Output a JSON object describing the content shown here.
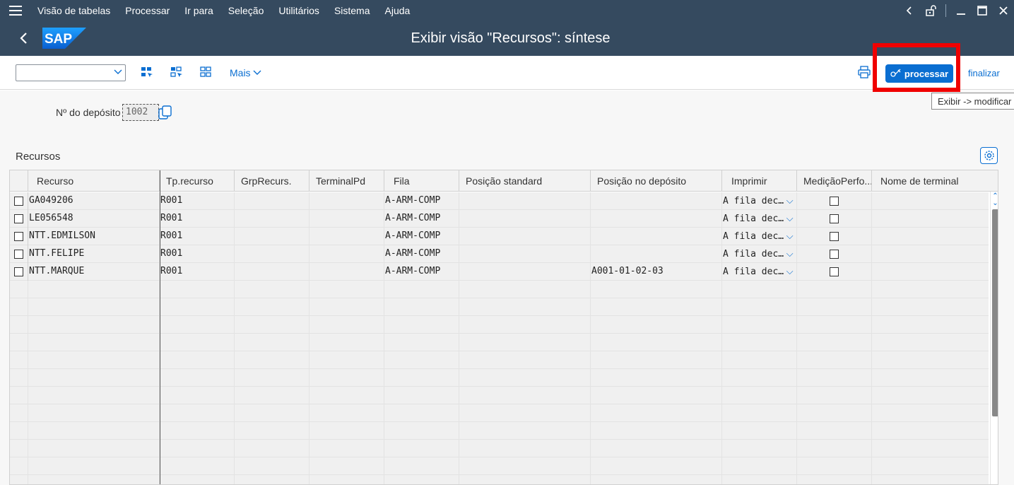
{
  "menu": {
    "items": [
      "Visão de tabelas",
      "Processar",
      "Ir para",
      "Seleção",
      "Utilitários",
      "Sistema",
      "Ajuda"
    ]
  },
  "window": {
    "title": "Exibir visão \"Recursos\": síntese",
    "logo_text": "SAP"
  },
  "toolbar": {
    "more_label": "Mais",
    "process_label": "processar",
    "finish_label": "finalizar",
    "tooltip": "Exibir -> modificar"
  },
  "filter": {
    "warehouse_label": "Nº do depósito",
    "warehouse_value": "1002"
  },
  "section": {
    "title": "Recursos"
  },
  "table": {
    "columns": [
      "Recurso",
      "Tp.recurso",
      "GrpRecurs.",
      "TerminalPd",
      "Fila",
      "Posição standard",
      "Posição no depósito",
      "Imprimir",
      "MediçãoPerfo...",
      "Nome de terminal"
    ],
    "rows": [
      {
        "recurso": "GA049206",
        "tp": "R001",
        "grp": "",
        "terminal": "",
        "fila": "A-ARM-COMP",
        "pos_std": "",
        "pos_dep": "",
        "imprimir": "A fila dec…",
        "medicao": false,
        "nome": ""
      },
      {
        "recurso": "LE056548",
        "tp": "R001",
        "grp": "",
        "terminal": "",
        "fila": "A-ARM-COMP",
        "pos_std": "",
        "pos_dep": "",
        "imprimir": "A fila dec…",
        "medicao": false,
        "nome": ""
      },
      {
        "recurso": "NTT.EDMILSON",
        "tp": "R001",
        "grp": "",
        "terminal": "",
        "fila": "A-ARM-COMP",
        "pos_std": "",
        "pos_dep": "",
        "imprimir": "A fila dec…",
        "medicao": false,
        "nome": ""
      },
      {
        "recurso": "NTT.FELIPE",
        "tp": "R001",
        "grp": "",
        "terminal": "",
        "fila": "A-ARM-COMP",
        "pos_std": "",
        "pos_dep": "",
        "imprimir": "A fila dec…",
        "medicao": false,
        "nome": ""
      },
      {
        "recurso": "NTT.MARQUE",
        "tp": "R001",
        "grp": "",
        "terminal": "",
        "fila": "A-ARM-COMP",
        "pos_std": "",
        "pos_dep": "A001-01-02-03",
        "imprimir": "A fila dec…",
        "medicao": false,
        "nome": ""
      }
    ]
  },
  "colors": {
    "shell": "#354a5f",
    "accent": "#0a6ed1",
    "highlight": "#f00000"
  }
}
